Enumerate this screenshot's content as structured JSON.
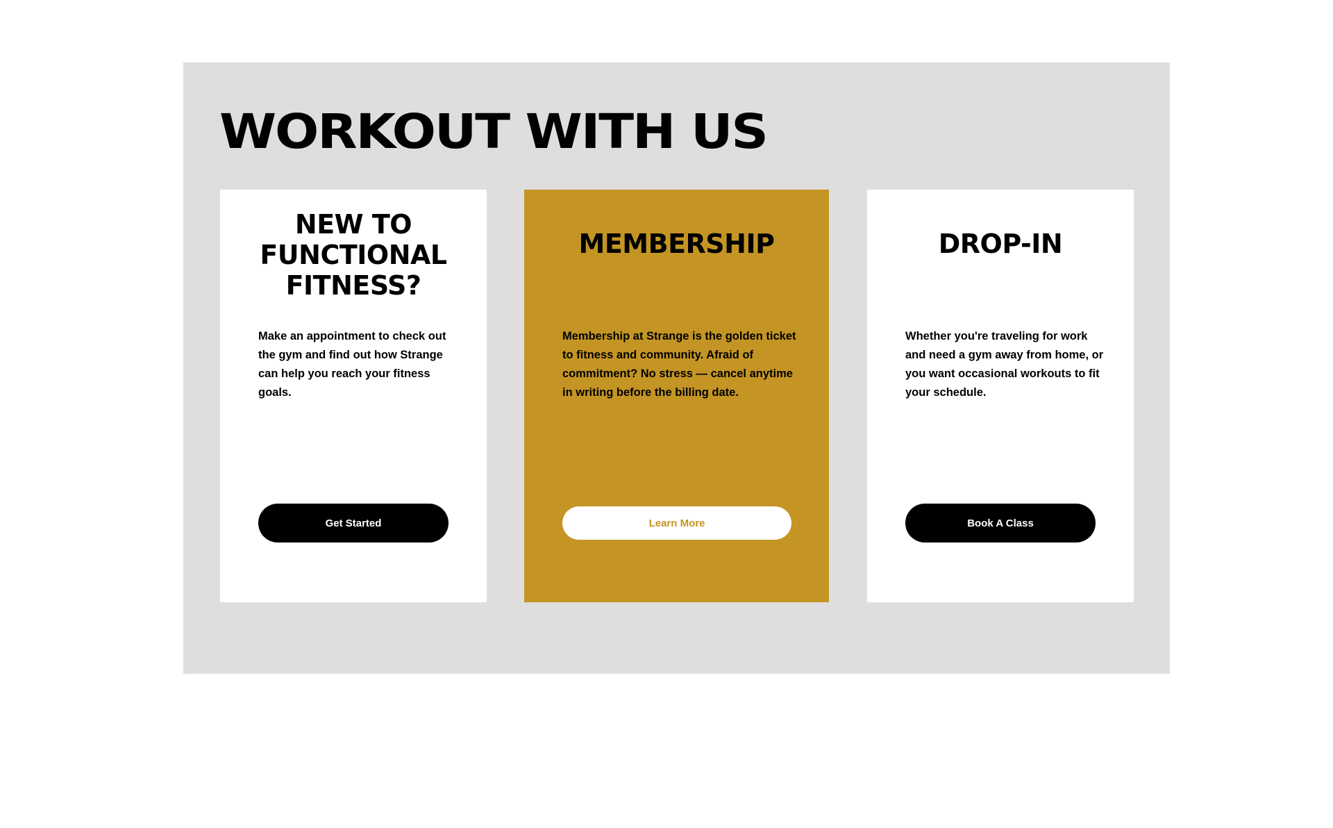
{
  "section": {
    "title": "WORKOUT WITH US",
    "background": "#dedede"
  },
  "cards": [
    {
      "title": "NEW TO\nFUNCTIONAL\nFITNESS?",
      "description": "Make an appointment to check out the gym and find out how Strange can help you reach your fitness goals.",
      "button_label": "Get Started",
      "background": "#ffffff"
    },
    {
      "title": "MEMBERSHIP",
      "description": "Membership at Strange is the golden ticket to fitness and community.  Afraid of commitment? No stress — cancel anytime in writing before the billing date.",
      "button_label": "Learn More",
      "background": "#c49524"
    },
    {
      "title": "DROP-IN",
      "description": "Whether you're traveling for work and need a gym away from home, or you want occasional workouts to fit your schedule.",
      "button_label": "Book A Class",
      "background": "#ffffff"
    }
  ],
  "colors": {
    "accent_gold": "#c49524",
    "button_dark": "#000000",
    "text": "#000000"
  }
}
